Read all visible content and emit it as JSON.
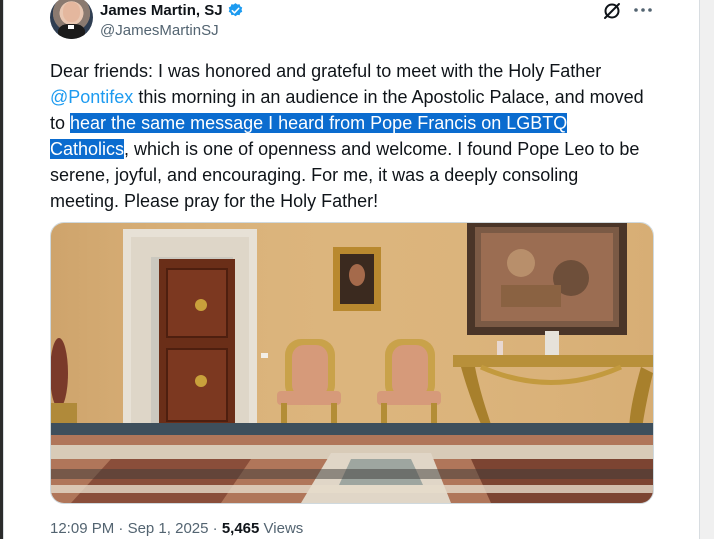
{
  "tweet": {
    "author": {
      "display_name": "James Martin, SJ",
      "handle": "@JamesMartinSJ",
      "verified": true
    },
    "text": {
      "part1": "Dear friends: I was honored and grateful to meet with the Holy Father ",
      "mention": "@Pontifex",
      "part2": " this morning in an audience in the Apostolic Palace, and moved to ",
      "highlight": "hear the same message I heard from Pope Francis on LGBTQ Catholics",
      "part3": ", which is one of openness and welcome. I found Pope Leo to be serene, joyful, and encouraging. For me, it was a deeply consoling meeting. Please pray for the Holy Father!"
    },
    "photo_alt_icon": "image",
    "meta": {
      "time": "12:09 PM",
      "separator": "·",
      "date": "Sep 1, 2025",
      "views_count": "5,465",
      "views_label": "Views"
    }
  },
  "icons": {
    "verified": "verified-badge-icon",
    "grok": "grok-icon",
    "more": "more-options-icon"
  },
  "colors": {
    "accent": "#1d9bf0",
    "text_highlight_bg": "#0b6ccf",
    "muted": "#536471",
    "text": "#0f1419"
  }
}
